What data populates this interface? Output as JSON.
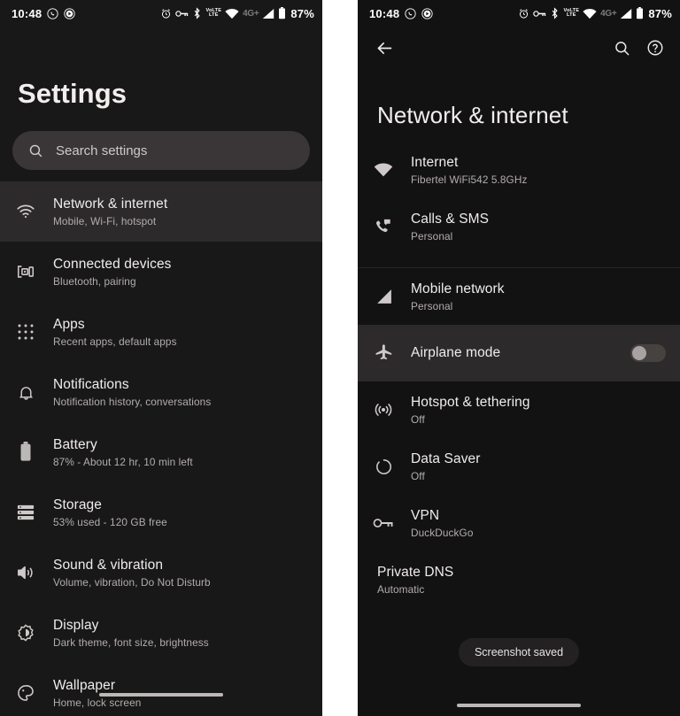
{
  "status_bar": {
    "time": "10:48",
    "left_icons": [
      "whatsapp-icon",
      "app-circle-icon"
    ],
    "right_icons": [
      "alarm-icon",
      "vpn-key-icon",
      "bluetooth-icon",
      "volte-icon",
      "wifi-icon",
      "mobile-data-icon",
      "signal-icon",
      "battery-icon"
    ],
    "volte_top": "VoLTE",
    "volte_bottom": "LTE",
    "network_type": "4G+",
    "battery": "87%"
  },
  "left_panel": {
    "title": "Settings",
    "search": {
      "placeholder": "Search settings",
      "icon": "search-icon"
    },
    "items": [
      {
        "icon": "wifi-icon",
        "title": "Network & internet",
        "subtitle": "Mobile, Wi-Fi, hotspot",
        "highlighted": true
      },
      {
        "icon": "connected-devices-icon",
        "title": "Connected devices",
        "subtitle": "Bluetooth, pairing",
        "highlighted": false
      },
      {
        "icon": "apps-grid-icon",
        "title": "Apps",
        "subtitle": "Recent apps, default apps",
        "highlighted": false
      },
      {
        "icon": "bell-icon",
        "title": "Notifications",
        "subtitle": "Notification history, conversations",
        "highlighted": false
      },
      {
        "icon": "battery-icon",
        "title": "Battery",
        "subtitle": "87% - About 12 hr, 10 min left",
        "highlighted": false
      },
      {
        "icon": "storage-icon",
        "title": "Storage",
        "subtitle": "53% used - 120 GB free",
        "highlighted": false
      },
      {
        "icon": "sound-icon",
        "title": "Sound & vibration",
        "subtitle": "Volume, vibration, Do Not Disturb",
        "highlighted": false
      },
      {
        "icon": "display-brightness-icon",
        "title": "Display",
        "subtitle": "Dark theme, font size, brightness",
        "highlighted": false
      },
      {
        "icon": "wallpaper-palette-icon",
        "title": "Wallpaper",
        "subtitle": "Home, lock screen",
        "highlighted": false
      }
    ]
  },
  "right_panel": {
    "appbar": {
      "back_icon": "back-arrow-icon",
      "search_icon": "search-icon",
      "help_icon": "help-circle-icon"
    },
    "title": "Network & internet",
    "groups": [
      {
        "items": [
          {
            "icon": "wifi-icon",
            "title": "Internet",
            "subtitle": "Fibertel WiFi542 5.8GHz",
            "highlighted": false,
            "toggle": null
          },
          {
            "icon": "calls-sms-icon",
            "title": "Calls & SMS",
            "subtitle": "Personal",
            "highlighted": false,
            "toggle": null
          }
        ]
      },
      {
        "items": [
          {
            "icon": "signal-bars-icon",
            "title": "Mobile network",
            "subtitle": "Personal",
            "highlighted": false,
            "toggle": null
          },
          {
            "icon": "airplane-icon",
            "title": "Airplane mode",
            "subtitle": "",
            "highlighted": true,
            "toggle": "off"
          },
          {
            "icon": "hotspot-icon",
            "title": "Hotspot & tethering",
            "subtitle": "Off",
            "highlighted": false,
            "toggle": null
          },
          {
            "icon": "data-saver-icon",
            "title": "Data Saver",
            "subtitle": "Off",
            "highlighted": false,
            "toggle": null
          },
          {
            "icon": "vpn-key-icon",
            "title": "VPN",
            "subtitle": "DuckDuckGo",
            "highlighted": false,
            "toggle": null
          },
          {
            "icon": "",
            "title": "Private DNS",
            "subtitle": "Automatic",
            "highlighted": false,
            "toggle": null
          }
        ]
      }
    ],
    "toast": "Screenshot saved"
  },
  "colors": {
    "background": "#191818",
    "background_right": "#131212",
    "highlight": "#2c2a2a",
    "search_field": "#3a3536",
    "text_primary": "#f0ecec",
    "text_secondary": "#b3adad"
  }
}
